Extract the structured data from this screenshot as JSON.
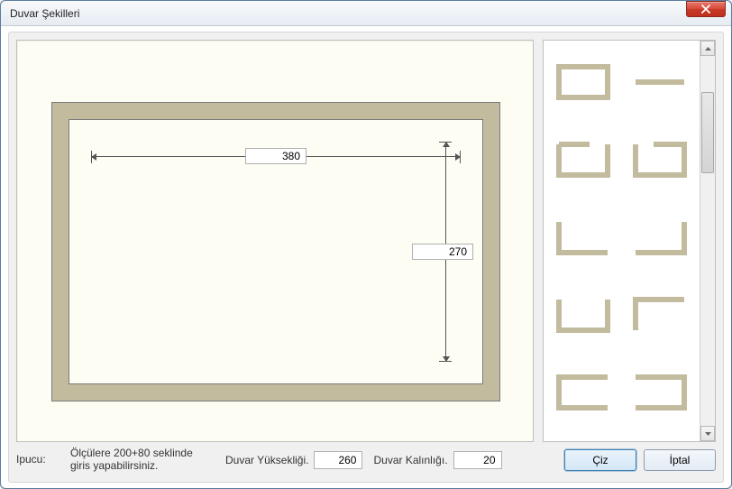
{
  "window": {
    "title": "Duvar Şekilleri"
  },
  "canvas": {
    "width_value": "380",
    "height_value": "270"
  },
  "shapes": {
    "items": [
      {
        "id": "closed-rect"
      },
      {
        "id": "single-line"
      },
      {
        "id": "open-top-right"
      },
      {
        "id": "open-top-left"
      },
      {
        "id": "l-bottom-left"
      },
      {
        "id": "l-bottom-right"
      },
      {
        "id": "u-open-top"
      },
      {
        "id": "l-top-right"
      },
      {
        "id": "c-open-right"
      },
      {
        "id": "c-open-left"
      }
    ]
  },
  "footer": {
    "hint_label": "Ipucu:",
    "hint_text": "Ölçülere 200+80 seklinde\ngiris yapabilirsiniz.",
    "height_label": "Duvar Yüksekliği.",
    "height_value": "260",
    "thickness_label": "Duvar Kalınlığı.",
    "thickness_value": "20",
    "draw_label": "Çiz",
    "cancel_label": "İptal"
  },
  "colors": {
    "wall": "#c3bb9e"
  }
}
